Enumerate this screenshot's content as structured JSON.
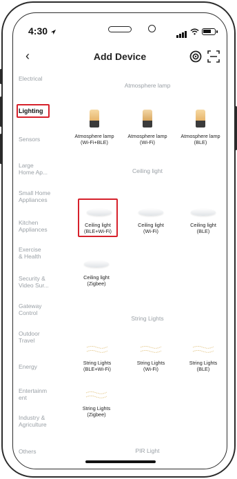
{
  "status_bar": {
    "time": "4:30"
  },
  "nav": {
    "title": "Add Device",
    "back_icon": "back-arrow",
    "right_icons": [
      "scan-circle-icon",
      "scan-frame-icon"
    ]
  },
  "sidebar": {
    "items": [
      {
        "label": "Electrical",
        "active": false
      },
      {
        "label": "Lighting",
        "active": true
      },
      {
        "label": "Sensors",
        "active": false
      },
      {
        "label": "Large\nHome Ap...",
        "active": false
      },
      {
        "label": "Small Home\nAppliances",
        "active": false
      },
      {
        "label": "Kitchen\nAppliances",
        "active": false
      },
      {
        "label": "Exercise\n& Health",
        "active": false
      },
      {
        "label": "Security &\nVideo Sur...",
        "active": false
      },
      {
        "label": "Gateway\nControl",
        "active": false
      },
      {
        "label": "Outdoor\nTravel",
        "active": false
      },
      {
        "label": "Energy",
        "active": false
      },
      {
        "label": "Entertainm\nent",
        "active": false
      },
      {
        "label": "Industry &\nAgriculture",
        "active": false
      },
      {
        "label": "Others",
        "active": false
      }
    ]
  },
  "sections": {
    "atmosphere": {
      "title": "Atmosphere lamp",
      "items": [
        "Atmosphere lamp\n(Wi-Fi+BLE)",
        "Atmosphere lamp\n(Wi-Fi)",
        "Atmosphere lamp\n(BLE)"
      ]
    },
    "ceiling": {
      "title": "Ceiling light",
      "items": [
        "Ceiling light\n(BLE+Wi-Fi)",
        "Ceiling light\n(Wi-Fi)",
        "Ceiling light\n(BLE)",
        "Ceiling light\n(Zigbee)"
      ]
    },
    "string": {
      "title": "String Lights",
      "items": [
        "String Lights\n(BLE+Wi-Fi)",
        "String Lights\n(Wi-Fi)",
        "String Lights\n(BLE)",
        "String Lights\n(Zigbee)"
      ]
    },
    "pir": {
      "title": "PIR Light"
    }
  },
  "colors": {
    "highlight": "#d6202a",
    "muted_text": "#9aa0a6",
    "text": "#222222"
  }
}
